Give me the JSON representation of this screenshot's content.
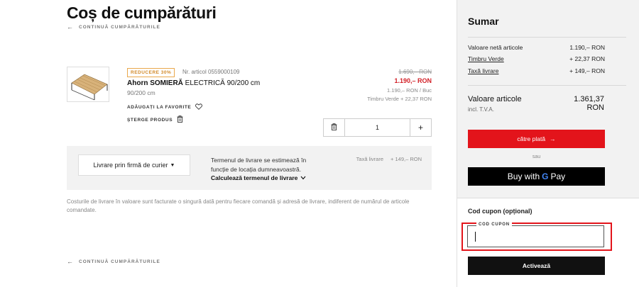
{
  "page": {
    "title": "Coș de cumpărături",
    "continue_shopping": "CONTINUĂ CUMPĂRĂTURILE"
  },
  "item": {
    "badge": "REDUCERE 30%",
    "sku": "Nr. articol 0559000109",
    "name_bold": "Ahorn SOMIERĂ",
    "name_rest": " ELECTRICĂ 90/200 cm",
    "size": "90/200 cm",
    "add_favorites": "ADĂUGAȚI LA FAVORITE",
    "delete_product": "ȘTERGE PRODUS",
    "price_old": "1.690,– RON",
    "price_new": "1.190,– RON",
    "price_unit": "1.190,– RON / Buc",
    "green_stamp": "Timbru Verde + 22,37 RON",
    "quantity": "1",
    "plus": "+"
  },
  "delivery": {
    "method": "Livrare prin firmă de curier",
    "info": "Termenul de livrare se estimează în funcție de locația dumneavoastră.",
    "calc": "Calculează termenul de livrare",
    "tax_label": "Taxă livrare",
    "tax_value": "+ 149,– RON"
  },
  "note": "Costurile de livrare în valoare sunt facturate o singură dată pentru fiecare comandă și adresă de livrare, indiferent de numărul de articole comandate.",
  "summary": {
    "title": "Sumar",
    "rows": [
      {
        "label": "Valoare netă articole",
        "value": "1.190,– RON"
      },
      {
        "label": "Timbru Verde",
        "value": "+ 22,37 RON"
      },
      {
        "label": "Taxă livrare",
        "value": "+ 149,– RON"
      }
    ],
    "total_label": "Valoare articole",
    "total_value": "1.361,37 RON",
    "vat_note": "incl. T.V.A.",
    "checkout": "către plată",
    "or": "sau",
    "gpay_prefix": "Buy with",
    "gpay_g": "G",
    "gpay_suffix": "Pay"
  },
  "coupon": {
    "title": "Cod cupon (opțional)",
    "field_label": "COD CUPON",
    "value": "",
    "activate": "Activează"
  },
  "colors": {
    "accent_red": "#e3141b",
    "badge_orange": "#d28a2a",
    "price_red": "#d21f26"
  }
}
